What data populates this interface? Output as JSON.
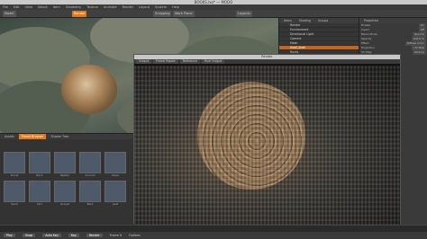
{
  "window": {
    "title": "BOOKS.lxo* — MODO"
  },
  "menubar": [
    "File",
    "Edit",
    "View",
    "Select",
    "Item",
    "Geometry",
    "Texture",
    "Animate",
    "Render",
    "Layout",
    "System",
    "Help"
  ],
  "toolbar": {
    "model_label": "Model",
    "render_label": "Render",
    "snapping_label": "Snapping",
    "work_plane_label": "Work Plane",
    "layouts_label": "Layouts"
  },
  "bottompanel": {
    "tabs": [
      "Assets",
      "Preset Browser",
      "Shader Tree"
    ],
    "active_tab": "Preset Browser",
    "tiles": [
      "Stone",
      "Rock",
      "Pebble",
      "Ground",
      "Moss",
      "Sand",
      "Dirt",
      "Gravel",
      "Bark",
      "Leaf"
    ]
  },
  "renderwin": {
    "title": "Render",
    "tabs": [
      "Output",
      "Frame Passes",
      "Reference",
      "Final Output"
    ]
  },
  "rightpanel": {
    "tabs": [
      "Items",
      "Shading",
      "Groups"
    ],
    "tree": [
      "Render",
      "Environment",
      "Directional Light",
      "Camera",
      "Mesh",
      "Snail_Shell",
      "Rocks",
      "Ground_Plane",
      "Background"
    ],
    "selected_index": 5,
    "props_title": "Properties",
    "props": [
      {
        "name": "Enable",
        "value": "On"
      },
      {
        "name": "Invert",
        "value": "Off"
      },
      {
        "name": "Blend Mode",
        "value": "Normal"
      },
      {
        "name": "Opacity",
        "value": "100.0 %"
      },
      {
        "name": "Effect",
        "value": "Diffuse Color"
      },
      {
        "name": "Projection",
        "value": "UV Map"
      },
      {
        "name": "UV Map",
        "value": "Texture"
      }
    ]
  },
  "statusbar": {
    "items": [
      "Play",
      "Snap",
      "Auto Key",
      "Key",
      "Render"
    ],
    "frame_label": "Frame 0",
    "options_label": "Options"
  }
}
